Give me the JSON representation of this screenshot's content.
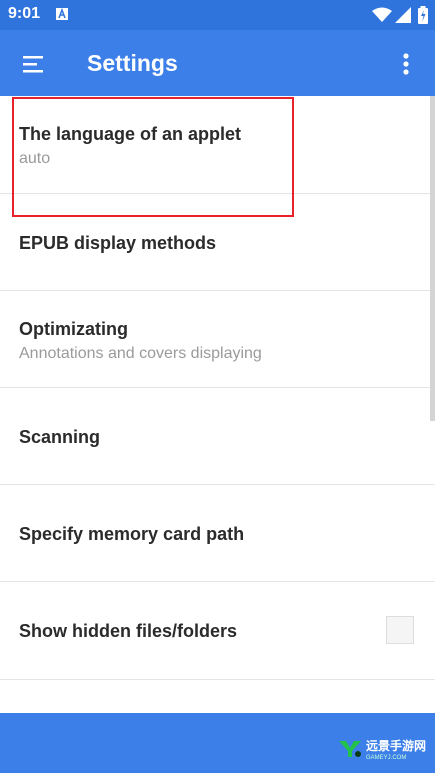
{
  "status_bar": {
    "time": "9:01",
    "notification_icon": "android-a-icon",
    "wifi_icon": "wifi-icon",
    "signal_icon": "signal-icon",
    "battery_icon": "battery-icon"
  },
  "app_bar": {
    "title": "Settings",
    "menu_icon": "menu-icon",
    "more_icon": "more-vert-icon",
    "color": "#3d7fe9"
  },
  "settings": [
    {
      "title": "The language of an applet",
      "subtitle": "auto"
    },
    {
      "title": "EPUB display methods",
      "subtitle": ""
    },
    {
      "title": "Optimizating",
      "subtitle": "Annotations and covers displaying"
    },
    {
      "title": "Scanning",
      "subtitle": ""
    },
    {
      "title": "Specify memory card path",
      "subtitle": ""
    },
    {
      "title": "Show hidden files/folders",
      "subtitle": "",
      "checkbox": false
    }
  ],
  "highlight": {
    "color": "#e8212a"
  },
  "watermark": {
    "brand": "远景手游网",
    "url": "GAMEYJ.COM"
  }
}
